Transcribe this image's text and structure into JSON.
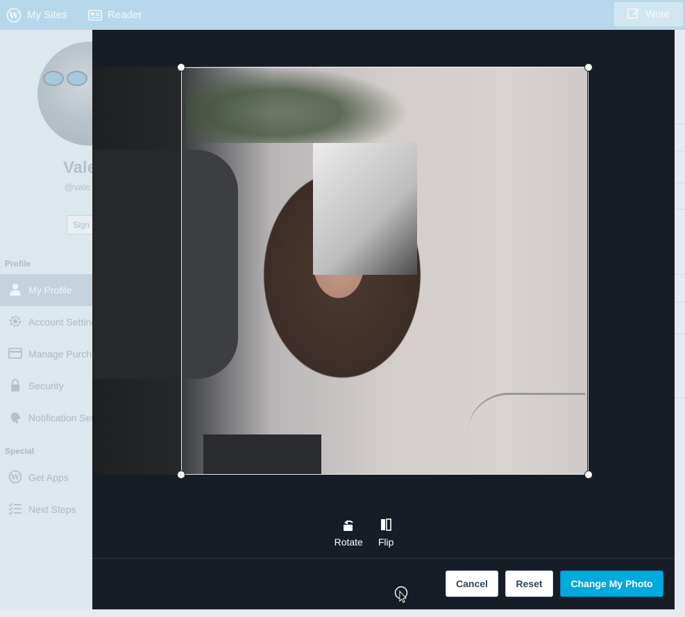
{
  "masterbar": {
    "my_sites": "My Sites",
    "reader": "Reader",
    "write": "Write"
  },
  "sidebar": {
    "display_name": "Vale",
    "username": "@vale",
    "sign_out": "Sign Out",
    "section_profile": "Profile",
    "section_special": "Special",
    "items": [
      {
        "label": "My Profile",
        "icon": "person-icon",
        "active": true
      },
      {
        "label": "Account Settings",
        "icon": "gear-icon"
      },
      {
        "label": "Manage Purchases",
        "icon": "credit-card-icon"
      },
      {
        "label": "Security",
        "icon": "lock-icon"
      },
      {
        "label": "Notification Settings",
        "icon": "bell-icon"
      }
    ],
    "special_items": [
      {
        "label": "Get Apps",
        "icon": "wordpress-icon"
      },
      {
        "label": "Next Steps",
        "icon": "checklist-icon"
      }
    ]
  },
  "editor": {
    "rotate_label": "Rotate",
    "flip_label": "Flip",
    "cancel_label": "Cancel",
    "reset_label": "Reset",
    "change_photo_label": "Change My Photo"
  },
  "colors": {
    "accent": "#00aadc",
    "modal_bg": "#161d26",
    "masterbar": "#b6d8ea"
  }
}
